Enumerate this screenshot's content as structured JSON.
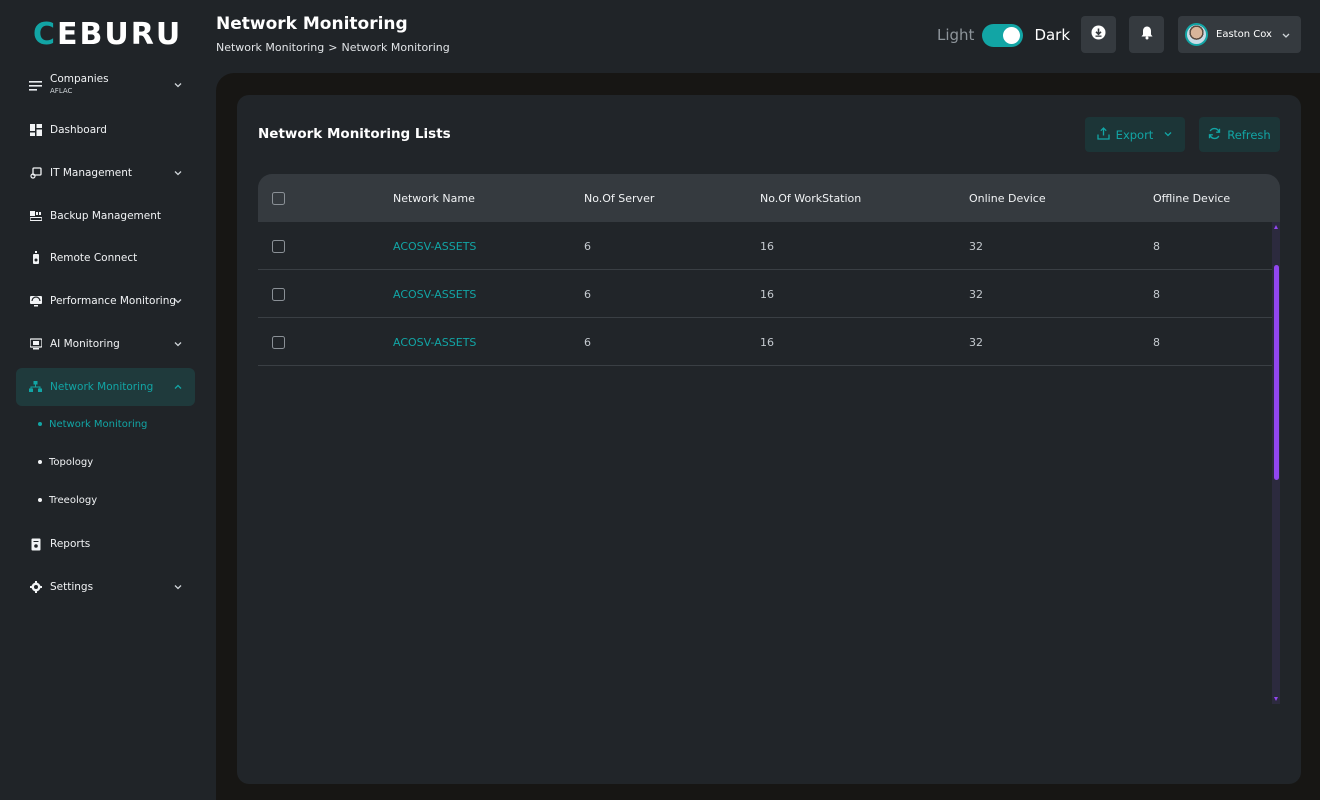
{
  "app": {
    "logo_accent": "C",
    "logo_rest": "EBURU"
  },
  "colors": {
    "accent": "#12a5a5",
    "scrollbar": "#9146f0",
    "background": "#202428",
    "card": "#212529"
  },
  "sidebar": {
    "companies": {
      "label": "Companies",
      "value": "AFLAC",
      "icon": "menu-lines-icon"
    },
    "items": [
      {
        "label": "Dashboard",
        "icon": "dashboard-grid-icon",
        "expandable": false
      },
      {
        "label": "IT Management",
        "icon": "it-management-icon",
        "expandable": true
      },
      {
        "label": "Backup Management",
        "icon": "backup-icon",
        "expandable": false
      },
      {
        "label": "Remote Connect",
        "icon": "remote-icon",
        "expandable": false
      },
      {
        "label": "Performance Monitoring",
        "icon": "performance-monitor-icon",
        "expandable": true
      },
      {
        "label": "AI Monitoring",
        "icon": "ai-monitor-icon",
        "expandable": true
      },
      {
        "label": "Network Monitoring",
        "icon": "network-icon",
        "expandable": true,
        "active": true
      },
      {
        "label": "Reports",
        "icon": "report-icon",
        "expandable": false
      },
      {
        "label": "Settings",
        "icon": "gear-icon",
        "expandable": true
      }
    ],
    "network_sub_items": [
      {
        "label": "Network Monitoring",
        "active": true
      },
      {
        "label": "Topology",
        "active": false
      },
      {
        "label": "Treeology",
        "active": false
      }
    ]
  },
  "header": {
    "title": "Network Monitoring",
    "breadcrumb": [
      "Network Monitoring",
      ">",
      "Network Monitoring"
    ],
    "theme": {
      "light_label": "Light",
      "dark_label": "Dark",
      "dark_enabled": true
    },
    "download_icon": "download-icon",
    "notification_icon": "bell-icon",
    "user": {
      "name": "Easton Cox"
    }
  },
  "card": {
    "title": "Network Monitoring Lists",
    "export_label": "Export",
    "refresh_label": "Refresh"
  },
  "table": {
    "columns": [
      "Network Name",
      "No.Of Server",
      "No.Of WorkStation",
      "Online Device",
      "Offline Device"
    ],
    "rows": [
      {
        "network_name": "ACOSV-ASSETS",
        "servers": "6",
        "workstations": "16",
        "online": "32",
        "offline": "8",
        "checked": false
      },
      {
        "network_name": "ACOSV-ASSETS",
        "servers": "6",
        "workstations": "16",
        "online": "32",
        "offline": "8",
        "checked": false
      },
      {
        "network_name": "ACOSV-ASSETS",
        "servers": "6",
        "workstations": "16",
        "online": "32",
        "offline": "8",
        "checked": false
      }
    ]
  }
}
